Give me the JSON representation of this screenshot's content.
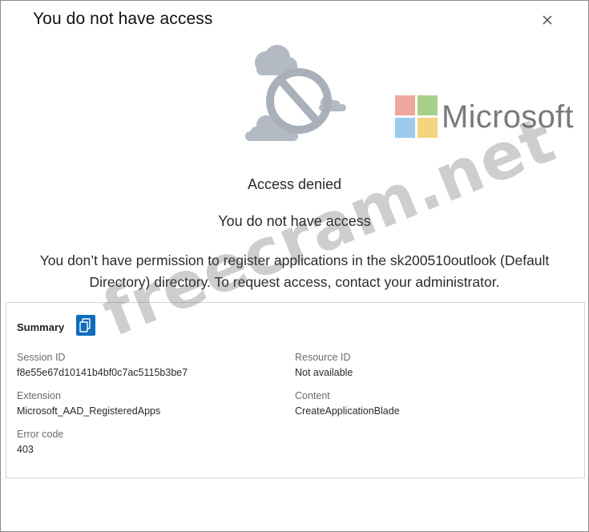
{
  "dialog": {
    "title": "You do not have access",
    "close_icon": "close-icon"
  },
  "illustration": {
    "icon": "blocked-cloud-icon"
  },
  "brand": {
    "name": "Microsoft",
    "logo_colors": [
      "#f25022",
      "#7fba00",
      "#00a4ef",
      "#ffb900"
    ]
  },
  "status": {
    "heading": "Access denied",
    "subheading": "You do not have access",
    "message_line1": "You don’t have permission to register applications in the sk200510outlook (Default",
    "message_line2": "Directory) directory. To request access, contact your administrator."
  },
  "summary": {
    "title": "Summary",
    "copy_icon": "copy-icon",
    "session_id_label": "Session ID",
    "session_id_value": "f8e55e67d10141b4bf0c7ac5115b3be7",
    "resource_id_label": "Resource ID",
    "resource_id_value": "Not available",
    "extension_label": "Extension",
    "extension_value": "Microsoft_AAD_RegisteredApps",
    "content_label": "Content",
    "content_value": "CreateApplicationBlade",
    "error_code_label": "Error code",
    "error_code_value": "403"
  },
  "watermark": {
    "text": "freecram.net"
  },
  "colors": {
    "accent": "#0f6cbd",
    "cloud": "#b8bec6"
  }
}
